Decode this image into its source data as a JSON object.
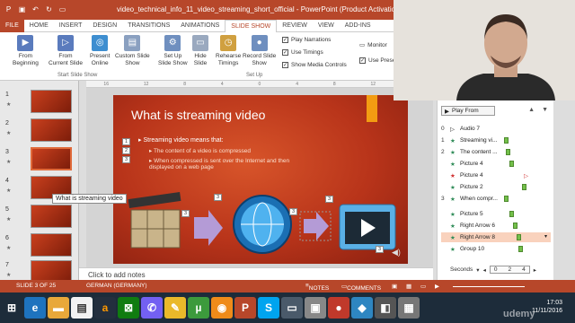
{
  "window": {
    "title": "video_technical_info_11_video_streaming_short_official - PowerPoint (Product Activation Failed)"
  },
  "tabs": [
    "FILE",
    "HOME",
    "INSERT",
    "DESIGN",
    "TRANSITIONS",
    "ANIMATIONS",
    "SLIDE SHOW",
    "REVIEW",
    "VIEW",
    "ADD-INS"
  ],
  "ribbon": {
    "from_beginning": "From\nBeginning",
    "from_current": "From\nCurrent Slide",
    "present_online": "Present\nOnline",
    "custom_slide_show": "Custom Slide\nShow",
    "group_start": "Start Slide Show",
    "set_up": "Set Up\nSlide Show",
    "hide_slide": "Hide\nSlide",
    "rehearse": "Rehearse\nTimings",
    "record": "Record Slide\nShow",
    "play_narrations": "Play Narrations",
    "use_timings": "Use Timings",
    "show_media": "Show Media Controls",
    "group_setup": "Set Up",
    "monitor": "Monitor",
    "use_presenter": "Use Prese"
  },
  "thumbnails": [
    {
      "n": "1"
    },
    {
      "n": "2"
    },
    {
      "n": "3"
    },
    {
      "n": "4"
    },
    {
      "n": "5"
    },
    {
      "n": "6"
    },
    {
      "n": "7"
    }
  ],
  "tooltip": "What is streaming video",
  "ruler": [
    "16",
    "12",
    "8",
    "4",
    "0",
    "4",
    "8",
    "12",
    "16"
  ],
  "slide": {
    "title": "What is streaming video",
    "bullet1": "Streaming video means that:",
    "bullet2": "The content of a video is compressed",
    "bullet3": "When compressed is sent over the Internet and then displayed on a web page",
    "badges": [
      "1",
      "2",
      "3",
      "3",
      "3",
      "3",
      "3",
      "3"
    ]
  },
  "notes": "Click to add notes",
  "anim_pane": {
    "play_from": "Play From",
    "items": [
      {
        "num": "0",
        "label": "Audio 7"
      },
      {
        "num": "1",
        "label": "Streaming vi..."
      },
      {
        "num": "2",
        "label": "The content ..."
      },
      {
        "num": "",
        "label": "Picture 4"
      },
      {
        "num": "",
        "label": "Picture 4"
      },
      {
        "num": "",
        "label": "Picture 2"
      },
      {
        "num": "3",
        "label": "When compr..."
      },
      {
        "num": "",
        "label": "Picture 5"
      },
      {
        "num": "",
        "label": "Right Arrow 6"
      },
      {
        "num": "",
        "label": "Right Arrow 8"
      },
      {
        "num": "",
        "label": "Group 10"
      }
    ],
    "seconds": "Seconds",
    "ticks": [
      "0",
      "2",
      "4"
    ]
  },
  "status": {
    "slide": "SLIDE 3 OF 25",
    "lang": "GERMAN (GERMANY)",
    "notes": "NOTES",
    "comments": "COMMENTS"
  },
  "clock": {
    "time": "17:03",
    "date": "11/11/2016"
  },
  "watermark": "udemy"
}
